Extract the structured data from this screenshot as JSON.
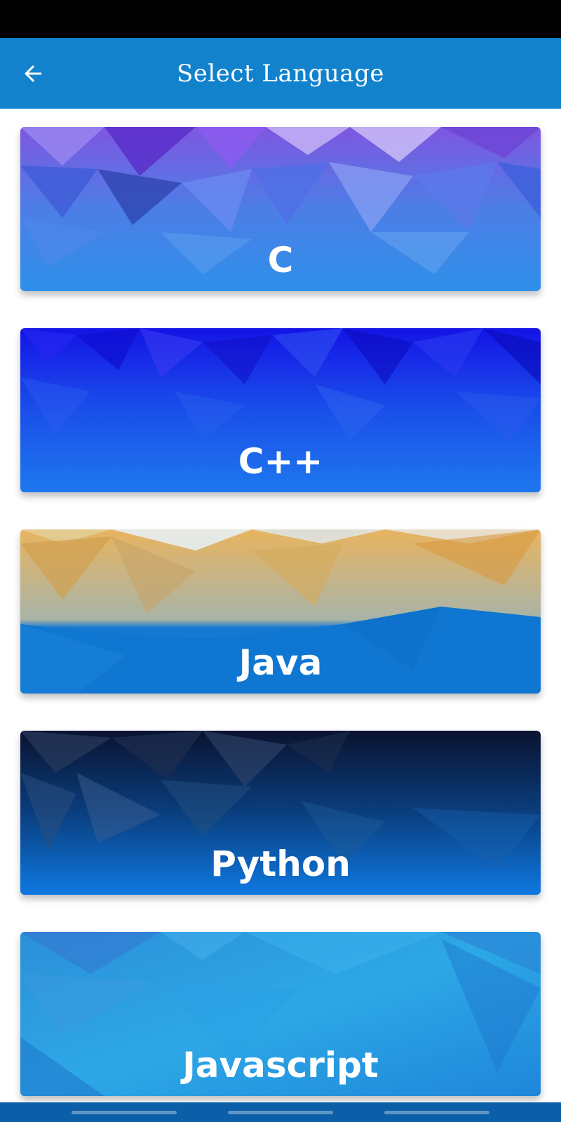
{
  "app_bar": {
    "title": "Select Language",
    "back_icon": "arrow-left-icon"
  },
  "languages": [
    {
      "label": "C"
    },
    {
      "label": "C++"
    },
    {
      "label": "Java"
    },
    {
      "label": "Python"
    },
    {
      "label": "Javascript"
    }
  ],
  "colors": {
    "app_bar": "#1282CD",
    "status_bar": "#000000",
    "nav_bar": "#0B5FA8"
  }
}
